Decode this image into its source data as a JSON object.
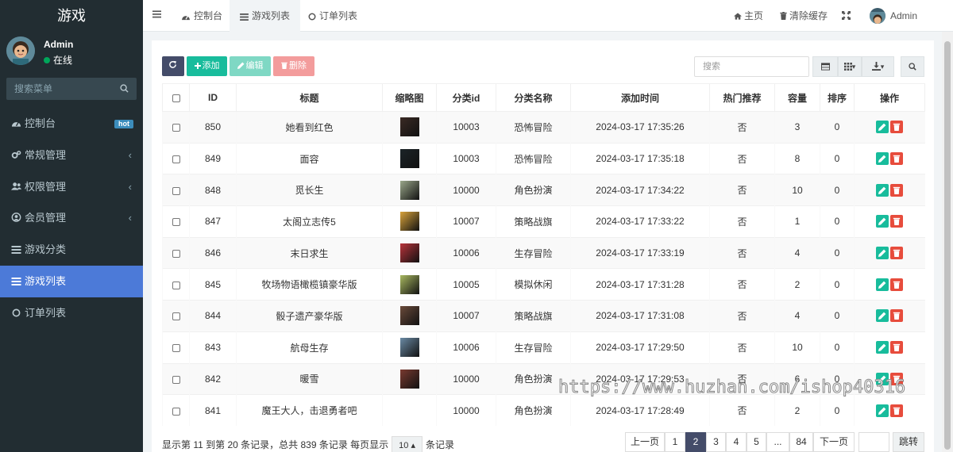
{
  "app": {
    "logo": "游戏"
  },
  "user": {
    "name": "Admin",
    "status": "在线"
  },
  "menu_search": {
    "placeholder": "搜索菜单"
  },
  "menu": [
    {
      "label": "控制台",
      "icon": "dashboard-icon",
      "badge": "hot"
    },
    {
      "label": "常规管理",
      "icon": "cogs-icon",
      "expandable": true
    },
    {
      "label": "权限管理",
      "icon": "users-icon",
      "expandable": true
    },
    {
      "label": "会员管理",
      "icon": "user-circle-icon",
      "expandable": true
    },
    {
      "label": "游戏分类",
      "icon": "list-icon"
    },
    {
      "label": "游戏列表",
      "icon": "list-icon",
      "active": true
    },
    {
      "label": "订单列表",
      "icon": "circle-icon"
    }
  ],
  "tabs": [
    {
      "label": "控制台",
      "icon": "dashboard-icon"
    },
    {
      "label": "游戏列表",
      "icon": "list-icon",
      "active": true
    },
    {
      "label": "订单列表",
      "icon": "circle-icon"
    }
  ],
  "topnav": {
    "home": "主页",
    "clear_cache": "清除缓存",
    "user": "Admin"
  },
  "toolbar": {
    "add": "添加",
    "edit": "编辑",
    "delete": "删除",
    "search_placeholder": "搜索"
  },
  "table": {
    "columns": [
      "ID",
      "标题",
      "缩略图",
      "分类id",
      "分类名称",
      "添加时间",
      "热门推荐",
      "容量",
      "排序",
      "操作"
    ],
    "rows": [
      {
        "id": "850",
        "title": "她看到红色",
        "thumb": "#3a2a24",
        "cat_id": "10003",
        "cat_name": "恐怖冒险",
        "time": "2024-03-17 17:35:26",
        "hot": "否",
        "capacity": "3",
        "sort": "0"
      },
      {
        "id": "849",
        "title": "面容",
        "thumb": "#1c2428",
        "cat_id": "10003",
        "cat_name": "恐怖冒险",
        "time": "2024-03-17 17:35:18",
        "hot": "否",
        "capacity": "8",
        "sort": "0"
      },
      {
        "id": "848",
        "title": "觅长生",
        "thumb": "#9aa78a",
        "cat_id": "10000",
        "cat_name": "角色扮演",
        "time": "2024-03-17 17:34:22",
        "hot": "否",
        "capacity": "10",
        "sort": "0"
      },
      {
        "id": "847",
        "title": "太阁立志传5",
        "thumb": "#d8a23a",
        "cat_id": "10007",
        "cat_name": "策略战旗",
        "time": "2024-03-17 17:33:22",
        "hot": "否",
        "capacity": "1",
        "sort": "0"
      },
      {
        "id": "846",
        "title": "末日求生",
        "thumb": "#b8333a",
        "cat_id": "10006",
        "cat_name": "生存冒险",
        "time": "2024-03-17 17:33:19",
        "hot": "否",
        "capacity": "4",
        "sort": "0"
      },
      {
        "id": "845",
        "title": "牧场物语橄榄镇豪华版",
        "thumb": "#a8b860",
        "cat_id": "10005",
        "cat_name": "模拟休闲",
        "time": "2024-03-17 17:31:28",
        "hot": "否",
        "capacity": "2",
        "sort": "0"
      },
      {
        "id": "844",
        "title": "骰子遗产豪华版",
        "thumb": "#6a4a3a",
        "cat_id": "10007",
        "cat_name": "策略战旗",
        "time": "2024-03-17 17:31:08",
        "hot": "否",
        "capacity": "4",
        "sort": "0"
      },
      {
        "id": "843",
        "title": "航母生存",
        "thumb": "#6a8aa4",
        "cat_id": "10006",
        "cat_name": "生存冒险",
        "time": "2024-03-17 17:29:50",
        "hot": "否",
        "capacity": "10",
        "sort": "0"
      },
      {
        "id": "842",
        "title": "暖雪",
        "thumb": "#7a3a30",
        "cat_id": "10000",
        "cat_name": "角色扮演",
        "time": "2024-03-17 17:29:53",
        "hot": "否",
        "capacity": "6",
        "sort": "0"
      },
      {
        "id": "841",
        "title": "魔王大人，击退勇者吧",
        "thumb": "",
        "cat_id": "10000",
        "cat_name": "角色扮演",
        "time": "2024-03-17 17:28:49",
        "hot": "否",
        "capacity": "2",
        "sort": "0"
      }
    ]
  },
  "footer": {
    "info_prefix": "显示第 11 到第 20 条记录，总共 839 条记录 每页显示",
    "page_size": "10",
    "info_suffix": "条记录"
  },
  "pagination": {
    "prev": "上一页",
    "pages": [
      "1",
      "2",
      "3",
      "4",
      "5",
      "...",
      "84"
    ],
    "active": "2",
    "next": "下一页",
    "jump": "跳转"
  },
  "watermark": "https://www.huzhan.com/ishop40316",
  "colors": {
    "sidebar": "#222d32",
    "active_menu": "#4c7ad8",
    "success": "#18bc9c",
    "danger": "#e74c3c",
    "primary_dark": "#444c69"
  }
}
